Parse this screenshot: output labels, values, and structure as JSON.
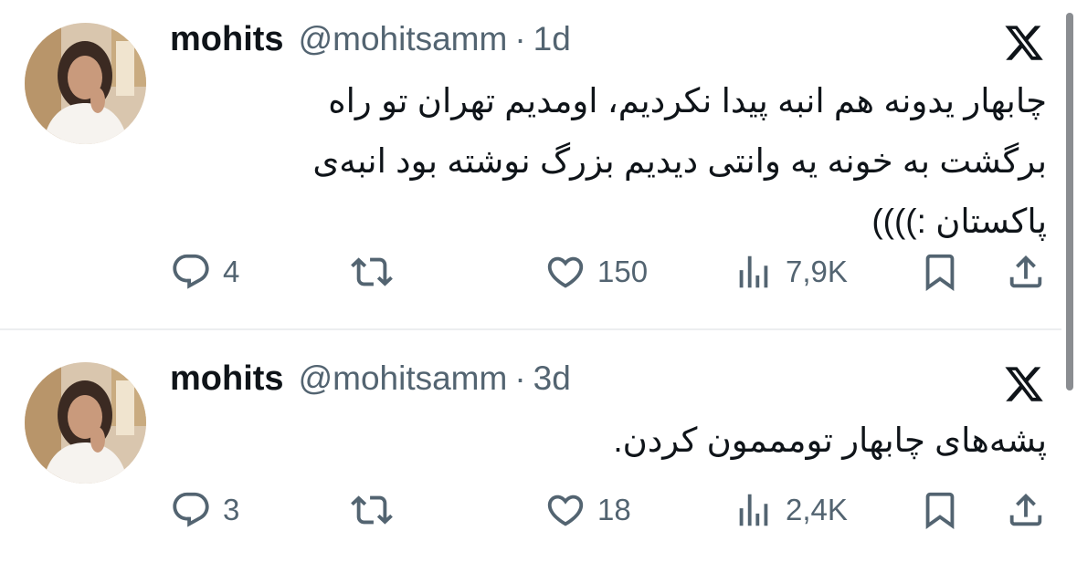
{
  "tweets": [
    {
      "name": "mohits",
      "handle": "@mohitsamm",
      "separator": "·",
      "time": "1d",
      "text_lines": [
        "چابهار یدونه هم انبه پیدا نکردیم، اومدیم تهران تو راه",
        "برگشت به خونه یه وانتی دیدیم بزرگ نوشته بود انبه‌ی",
        "پاکستان :))))"
      ],
      "replies": "4",
      "retweets": "",
      "likes": "150",
      "views": "7,9K"
    },
    {
      "name": "mohits",
      "handle": "@mohitsamm",
      "separator": "·",
      "time": "3d",
      "text_lines": [
        "پشه‌های چابهار تومممون کردن."
      ],
      "replies": "3",
      "retweets": "",
      "likes": "18",
      "views": "2,4K"
    }
  ],
  "icons": {
    "reply": "reply-icon",
    "retweet": "retweet-icon",
    "like": "heart-icon",
    "views": "views-icon",
    "bookmark": "bookmark-icon",
    "share": "share-icon",
    "logo": "x-logo-icon"
  },
  "colors": {
    "text": "#0f1419",
    "secondary": "#536471",
    "divider": "#eceef0"
  }
}
